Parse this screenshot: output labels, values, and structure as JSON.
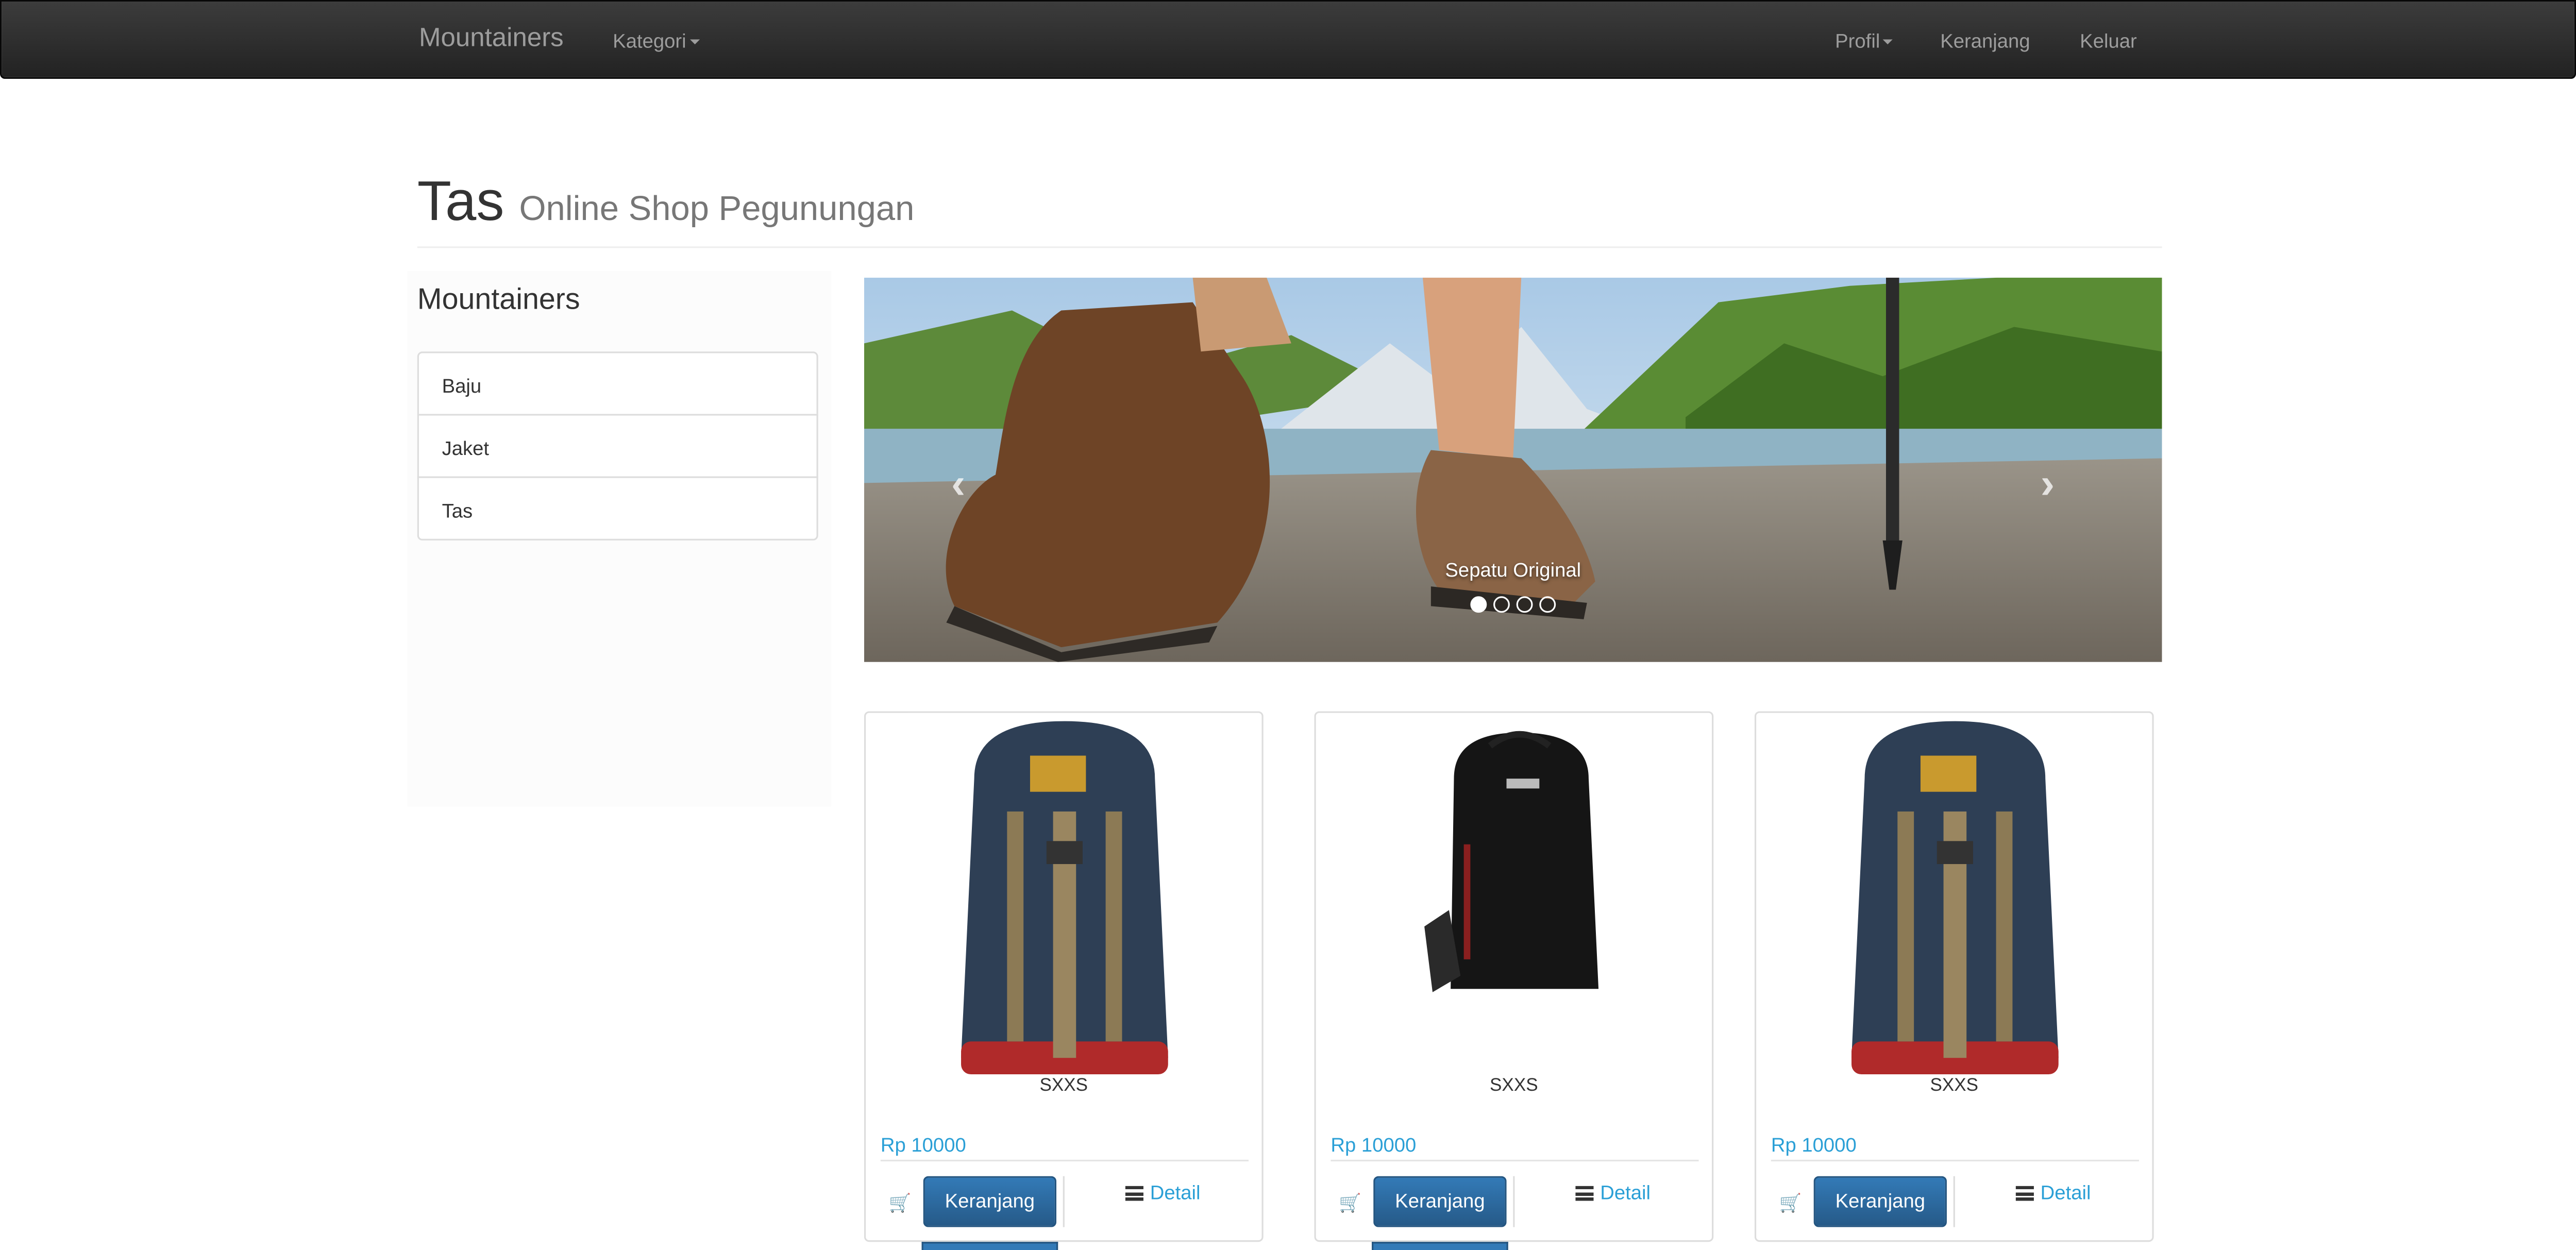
{
  "navbar": {
    "brand": "Mountainers",
    "kategori": "Kategori",
    "profil": "Profil",
    "keranjang": "Keranjang",
    "keluar": "Keluar"
  },
  "header": {
    "title": "Tas",
    "subtitle": "Online Shop Pegunungan"
  },
  "sidebar": {
    "title": "Mountainers",
    "items": [
      {
        "label": "Baju"
      },
      {
        "label": "Jaket"
      },
      {
        "label": "Tas"
      }
    ]
  },
  "carousel": {
    "caption": "Sepatu Original",
    "slide_count": 4,
    "active_index": 0,
    "prev_icon": "chevron-left-icon",
    "next_icon": "chevron-right-icon"
  },
  "products": [
    {
      "name": "SXXS",
      "price": "Rp 10000",
      "cart_label": "Keranjang",
      "detail_label": "Detail",
      "image": "blue-backpack"
    },
    {
      "name": "SXXS",
      "price": "Rp 10000",
      "cart_label": "Keranjang",
      "detail_label": "Detail",
      "image": "black-backpack"
    },
    {
      "name": "SXXS",
      "price": "Rp 10000",
      "cart_label": "Keranjang",
      "detail_label": "Detail",
      "image": "blue-backpack"
    }
  ],
  "colors": {
    "navbar_bg": "#222222",
    "link": "#2a9fd6",
    "primary_button": "#337ab7"
  }
}
